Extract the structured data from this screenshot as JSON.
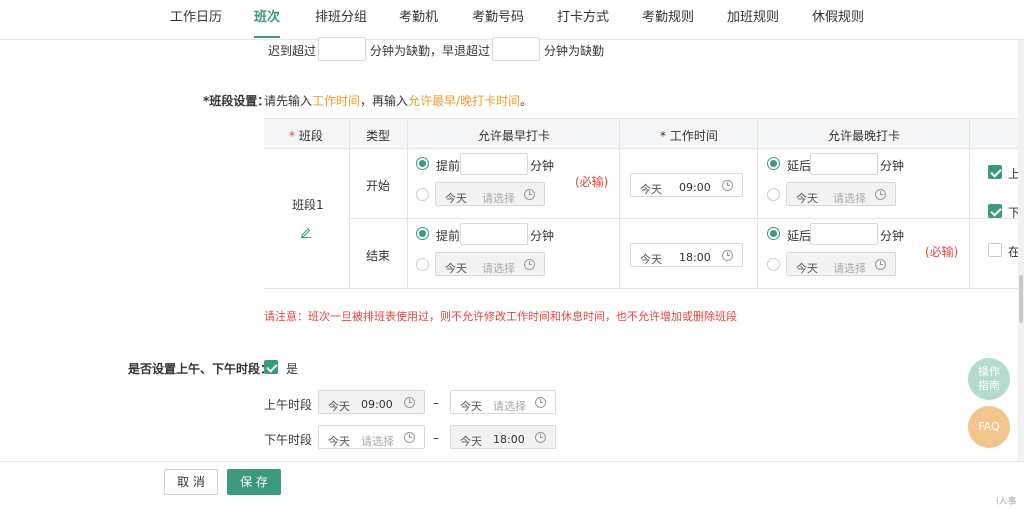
{
  "nav": {
    "tabs": [
      "工作日历",
      "班次",
      "排班分组",
      "考勤机",
      "考勤号码",
      "打卡方式",
      "考勤规则",
      "加班规则",
      "休假规则"
    ],
    "active_tab": "班次"
  },
  "late_row": {
    "late_prefix": "迟到超过",
    "late_suffix": "分钟为缺勤，早退超过",
    "early_suffix": "分钟为缺勤"
  },
  "segment_settings": {
    "label": "*班段设置：",
    "hint_1": "请先输入",
    "hint_work_time": "工作时间",
    "hint_2": "，再输入",
    "hint_allow": "允许最早/晚打卡时间",
    "hint_3": "。"
  },
  "table": {
    "headers": {
      "segment": "* 班段",
      "type": "类型",
      "earliest": "允许最早打卡",
      "work_time": "* 工作时间",
      "latest": "允许最晚打卡"
    },
    "segment_name": "班段1",
    "rows": [
      {
        "type": "开始",
        "early_opt1": "提前",
        "early_unit": "分钟",
        "early_day": "今天",
        "early_placeholder": "请选择",
        "required_note": "(必输)",
        "work_day": "今天",
        "work_time": "09:00",
        "late_opt1": "延后",
        "late_unit": "分钟",
        "late_day": "今天",
        "late_placeholder": "请选择",
        "side_label": "上"
      },
      {
        "type": "结束",
        "early_opt1": "提前",
        "early_unit": "分钟",
        "early_day": "今天",
        "early_placeholder": "请选择",
        "work_day": "今天",
        "work_time": "18:00",
        "late_opt1": "延后",
        "late_unit": "分钟",
        "late_day": "今天",
        "late_placeholder": "请选择",
        "required_note": "(必输)",
        "side_label": "下",
        "side_label_2": "在"
      }
    ]
  },
  "notice": "请注意：班次一旦被排班表使用过，则不允许修改工作时间和休息时间，也不允许增加或删除班段",
  "half_day": {
    "label": "是否设置上午、下午时段：",
    "checkbox_label": "是",
    "morning_label": "上午时段",
    "morning_start_day": "今天",
    "morning_start": "09:00",
    "morning_end_day": "今天",
    "morning_end_placeholder": "请选择",
    "afternoon_label": "下午时段",
    "afternoon_start_day": "今天",
    "afternoon_start_placeholder": "请选择",
    "afternoon_end_day": "今天",
    "afternoon_end": "18:00",
    "dash": "–"
  },
  "float_buttons": {
    "guide": "操作\n指南",
    "guide_line1": "操作",
    "guide_line2": "指南",
    "faq": "FAQ"
  },
  "footer": {
    "cancel": "取 消",
    "save": "保 存",
    "corner": "i人事"
  },
  "colors": {
    "primary": "#3b9a7d",
    "danger": "#e0473d",
    "accent": "#f29a2e"
  }
}
